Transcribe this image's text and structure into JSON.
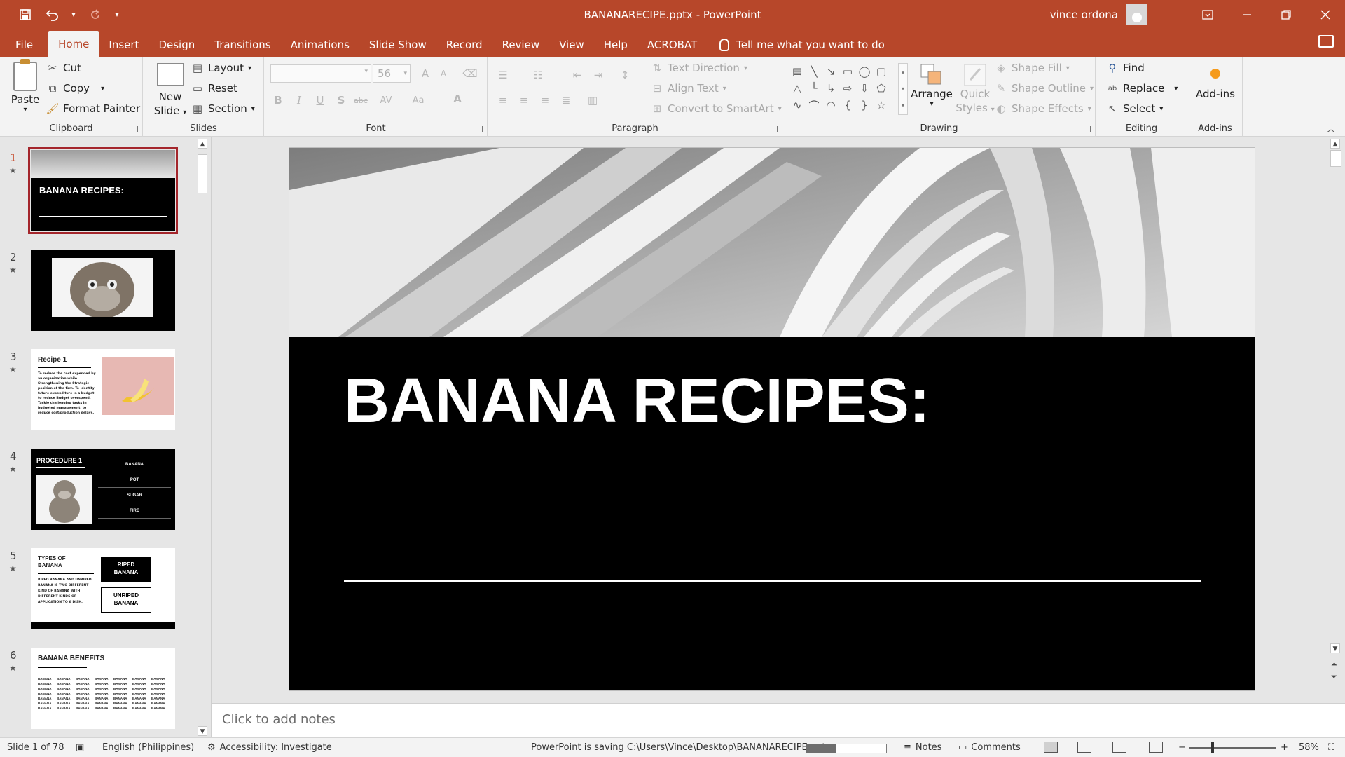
{
  "window": {
    "title": "BANANARECIPE.pptx  -  PowerPoint",
    "user_name": "vince ordona"
  },
  "qat": {
    "save": "save-icon",
    "undo": "undo-icon",
    "redo": "redo-icon"
  },
  "tabs": [
    "File",
    "Home",
    "Insert",
    "Design",
    "Transitions",
    "Animations",
    "Slide Show",
    "Record",
    "Review",
    "View",
    "Help",
    "ACROBAT"
  ],
  "active_tab": "Home",
  "tell_me": "Tell me what you want to do",
  "ribbon": {
    "clipboard": {
      "label": "Clipboard",
      "paste": "Paste",
      "cut": "Cut",
      "copy": "Copy",
      "format_painter": "Format Painter"
    },
    "slides": {
      "label": "Slides",
      "new_slide_1": "New",
      "new_slide_2": "Slide",
      "layout": "Layout",
      "reset": "Reset",
      "section": "Section"
    },
    "font": {
      "label": "Font",
      "size": "56"
    },
    "paragraph": {
      "label": "Paragraph",
      "text_direction": "Text Direction",
      "align_text": "Align Text",
      "convert_smartart": "Convert to SmartArt"
    },
    "drawing": {
      "label": "Drawing",
      "arrange": "Arrange",
      "quick_styles_1": "Quick",
      "quick_styles_2": "Styles",
      "shape_fill": "Shape Fill",
      "shape_outline": "Shape Outline",
      "shape_effects": "Shape Effects"
    },
    "editing": {
      "label": "Editing",
      "find": "Find",
      "replace": "Replace",
      "select": "Select"
    },
    "addins": {
      "label": "Add-ins",
      "addins": "Add-ins"
    }
  },
  "thumbnails": [
    {
      "num": "1",
      "title": "BANANA RECIPES:"
    },
    {
      "num": "2"
    },
    {
      "num": "3",
      "title": "Recipe 1",
      "body": "To reduce the cost expended by an organization while Strengthening the Strategic position of the firm. To Identify future expenditure in a budget to reduce Budget overspend. Tackle challenging tasks in budgeted management. to reduce cost/production delays."
    },
    {
      "num": "4",
      "title": "PROCEDURE 1",
      "items": [
        "BANANA",
        "POT",
        "SUGAR",
        "FIRE"
      ]
    },
    {
      "num": "5",
      "title_1": "TYPES OF",
      "title_2": "BANANA",
      "body": "RIPED BANANA AND UNRIPED BANANA IS TWO DIFFERENT KIND OF BANANA WITH DIFFERENT KINDS OF APPLICATION TO A DISH.",
      "box_1a": "RIPED",
      "box_1b": "BANANA",
      "box_2a": "UNRIPED",
      "box_2b": "BANANA"
    },
    {
      "num": "6",
      "title": "BANANA BENEFITS",
      "word": "BANANA"
    }
  ],
  "slide": {
    "title": "BANANA RECIPES:"
  },
  "notes": {
    "placeholder": "Click to add notes"
  },
  "status": {
    "slide_info": "Slide 1 of 78",
    "language": "English (Philippines)",
    "accessibility": "Accessibility: Investigate",
    "saving": "PowerPoint is saving C:\\Users\\Vince\\Desktop\\BANANARECIPE.pptx.",
    "save_progress": 0.38,
    "notes": "Notes",
    "comments": "Comments",
    "zoom": "58%",
    "zoom_level": 0.58
  }
}
